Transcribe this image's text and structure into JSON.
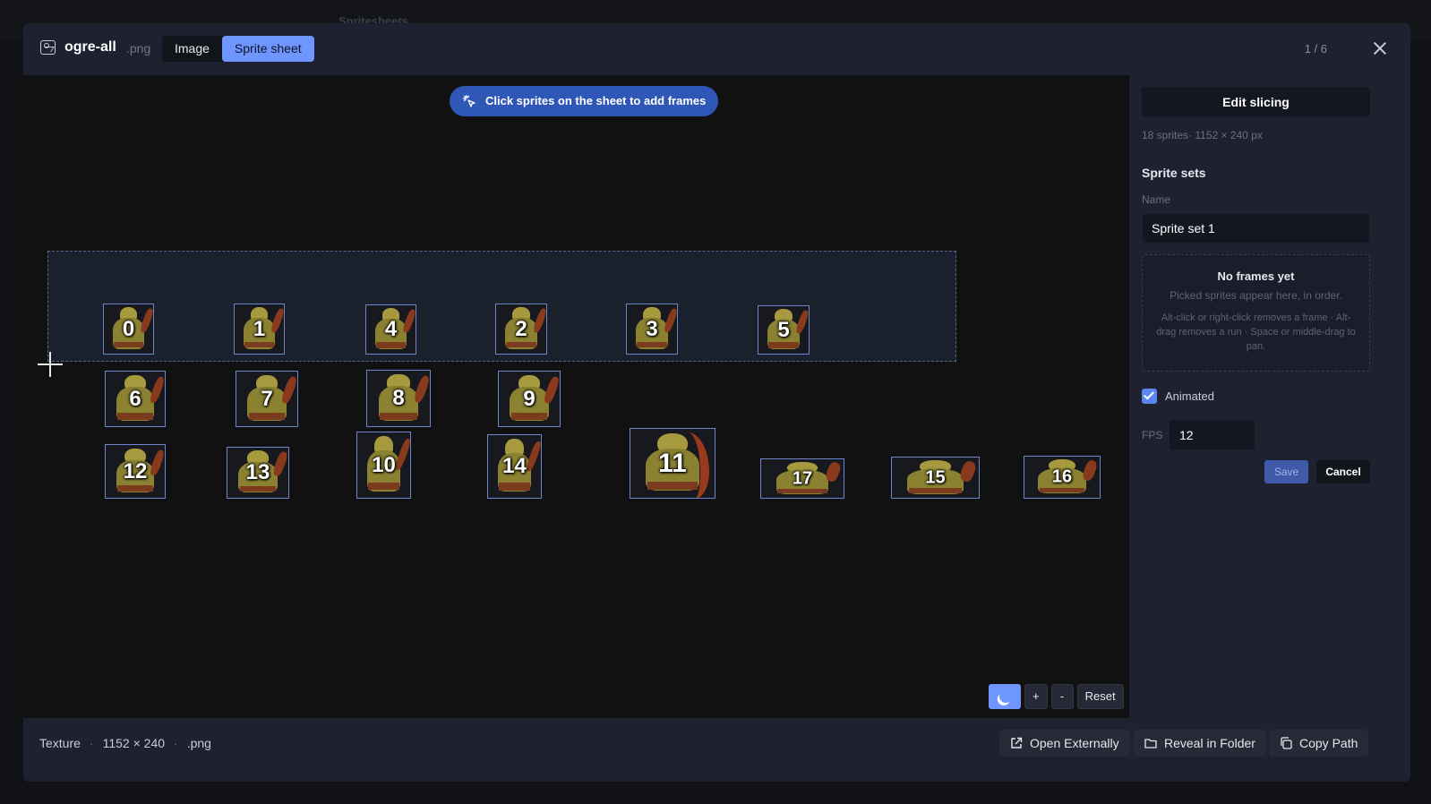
{
  "background": {
    "title": "Spritesheets"
  },
  "header": {
    "file_name": "ogre-all",
    "file_ext": ".png",
    "tabs": [
      {
        "label": "Image",
        "active": false
      },
      {
        "label": "Sprite sheet",
        "active": true
      }
    ],
    "counter": "1 / 6"
  },
  "canvas": {
    "hint": "Click sprites on the sheet to add frames",
    "sprites": [
      "0",
      "1",
      "4",
      "2",
      "3",
      "5",
      "6",
      "7",
      "8",
      "9",
      "12",
      "13",
      "10",
      "14",
      "11",
      "17",
      "15",
      "16"
    ]
  },
  "zoom": {
    "in_label": "+",
    "out_label": "-",
    "reset_label": "Reset"
  },
  "panel": {
    "edit_slicing": "Edit slicing",
    "meta": "18 sprites· 1152 × 240 px",
    "section_title": "Sprite sets",
    "name_label": "Name",
    "name_value": "Sprite set 1",
    "frames_empty_title": "No frames yet",
    "frames_empty_sub": "Picked sprites appear here, in order.",
    "frames_help": "Alt-click or right-click removes a frame · Alt-drag removes a run · Space or middle-drag to pan.",
    "animated_label": "Animated",
    "animated_checked": true,
    "fps_label": "FPS",
    "fps_value": "12",
    "save_label": "Save",
    "cancel_label": "Cancel"
  },
  "footer": {
    "kind": "Texture",
    "dimensions": "1152 × 240",
    "ext": ".png",
    "buttons": {
      "open_externally": "Open Externally",
      "reveal_in_folder": "Reveal in Folder",
      "copy_path": "Copy Path"
    }
  },
  "colors": {
    "accent": "#6f96ff",
    "hint_bg": "#2f57b8",
    "modal_bg": "#1e2230",
    "canvas_bg": "#111111"
  }
}
